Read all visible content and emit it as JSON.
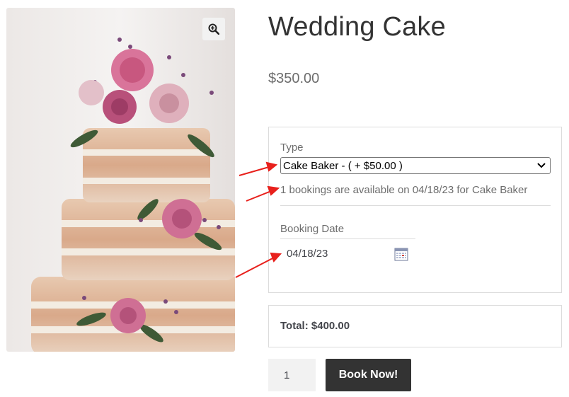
{
  "product": {
    "title": "Wedding Cake",
    "price": "$350.00",
    "image_description_icon": "cake-photo",
    "zoom_icon": "magnifier-plus-icon"
  },
  "booking": {
    "type_label": "Type",
    "type_selected": "Cake Baker - ( + $50.00 )",
    "availability": "1 bookings are available on 04/18/23 for Cake Baker",
    "date_label": "Booking Date",
    "date_value": "04/18/23",
    "calendar_icon": "calendar-icon"
  },
  "total": {
    "text": "Total: $400.00"
  },
  "cart": {
    "quantity": "1",
    "book_label": "Book Now!"
  },
  "colors": {
    "button_bg": "#333333",
    "annotation_arrow": "#e8201c",
    "border": "#dcdcdc"
  }
}
